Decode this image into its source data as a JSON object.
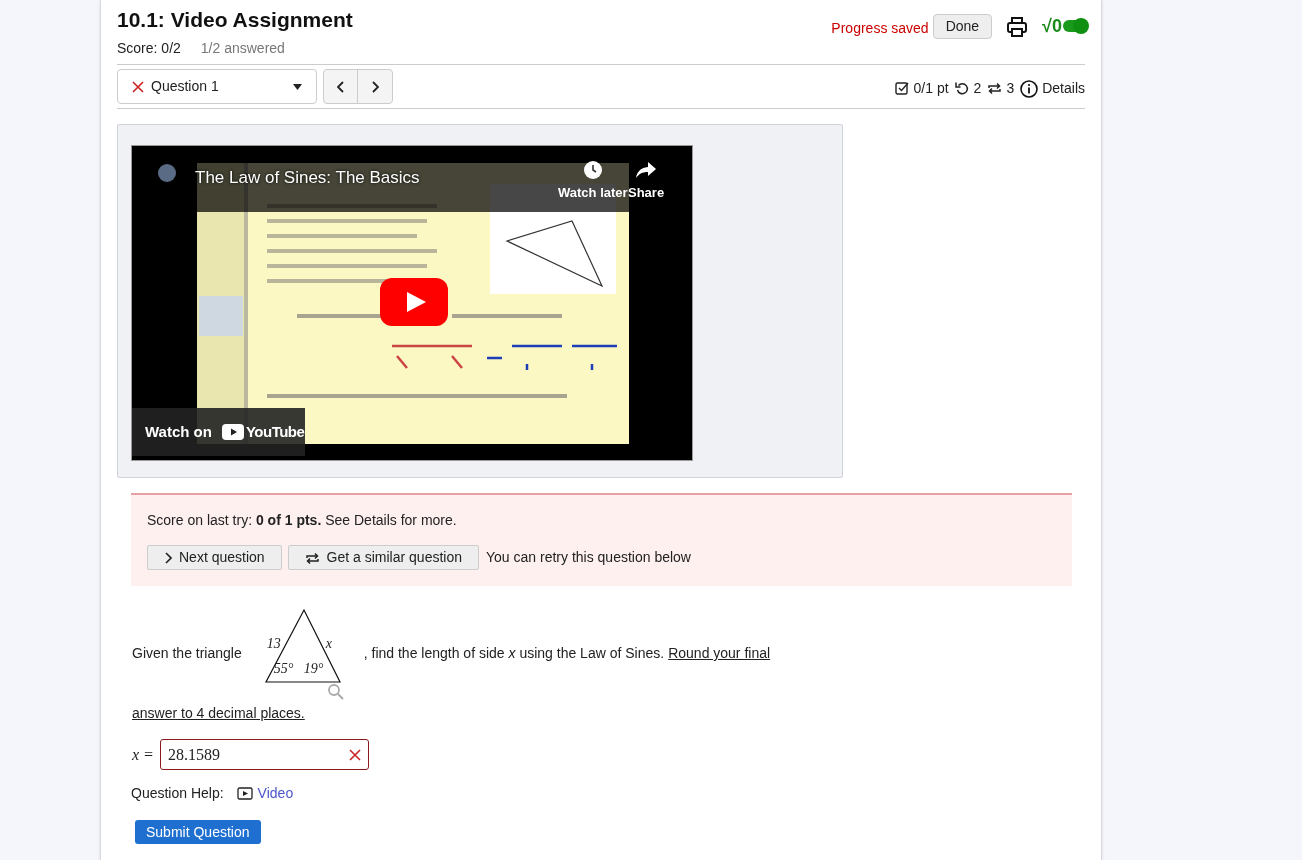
{
  "header": {
    "title": "10.1: Video Assignment",
    "score": "Score: 0/2",
    "answered": "1/2 answered",
    "progress": "Progress saved",
    "done_button": "Done",
    "math_toggle": {
      "label": "√0",
      "on": true
    }
  },
  "question_nav": {
    "question": {
      "label": "Question 1",
      "correct": false
    },
    "stats": [
      {
        "kind": "points",
        "text": "0/1 pt"
      },
      {
        "kind": "retries",
        "text": "2"
      },
      {
        "kind": "versions",
        "text": "3"
      },
      {
        "kind": "details",
        "text": "Details"
      }
    ]
  },
  "video": {
    "title": "The Law of Sines: The Basics",
    "watch_later": "Watch later",
    "share": "Share",
    "watch_on": "Watch on",
    "brand": "YouTube"
  },
  "feedback": {
    "text": "Score on last try: **0 of 1 pts.** See Details for more.",
    "buttons": [
      {
        "kind": "next",
        "label": "Next question"
      },
      {
        "kind": "similar",
        "label": "Get a similar question"
      }
    ],
    "note": "You can retry this question below"
  },
  "question": {
    "intro": "Given the triangle",
    "figure_labels": [
      "13",
      "x",
      "55°",
      "19°"
    ],
    "text": ", find the length of side *x* using the Law of Sines.",
    "instruction_lines": [
      "Round your final",
      "answer to 4 decimal places."
    ]
  },
  "answer": {
    "label": "x =",
    "value": "28.1589",
    "correct": false
  },
  "help": {
    "label": "Question Help:",
    "link": "Video"
  },
  "submit": "Submit Question"
}
